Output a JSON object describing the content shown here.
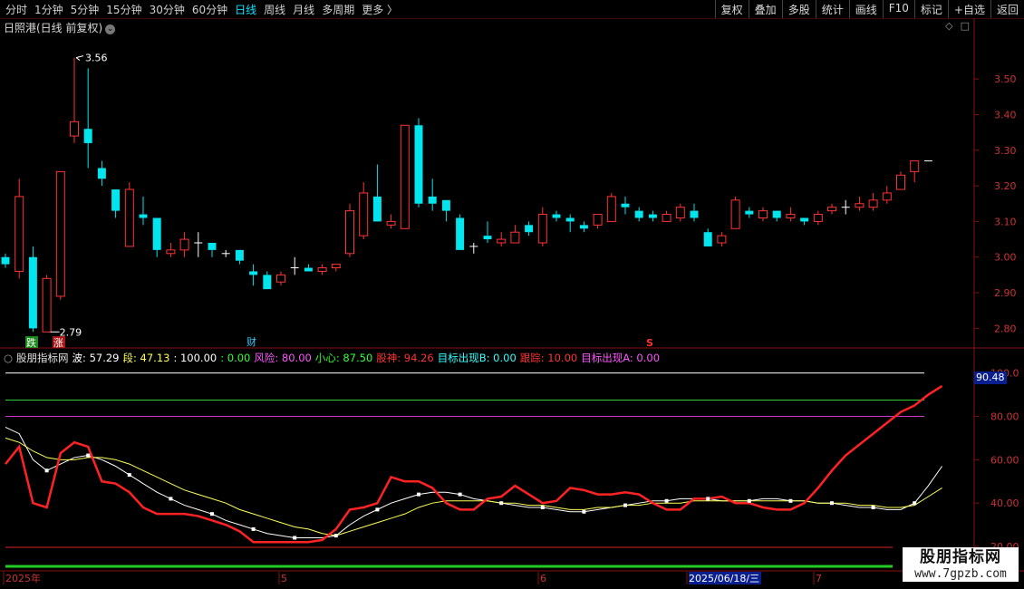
{
  "toolbar": {
    "periods": [
      "分时",
      "1分钟",
      "5分钟",
      "15分钟",
      "30分钟",
      "60分钟",
      "日线",
      "周线",
      "月线",
      "多周期",
      "更多"
    ],
    "active_period": "日线",
    "more_suffix": "〉",
    "right_buttons": [
      "复权",
      "叠加",
      "多股",
      "统计",
      "画线",
      "F10",
      "标记",
      "+自选",
      "返回"
    ]
  },
  "stock": {
    "title": "日照港(日线 前复权)",
    "chev": "⌄"
  },
  "top_icons": {
    "diamond": "◇",
    "square": "□"
  },
  "price_axis": {
    "ticks": [
      "3.50",
      "3.40",
      "3.30",
      "3.20",
      "3.10",
      "3.00",
      "2.90",
      "2.80"
    ]
  },
  "annotations": {
    "high": "3.56",
    "low": "2.79",
    "die": "跌",
    "zhang": "涨",
    "cai": "财",
    "s_mark": "S"
  },
  "indicator": {
    "name": "股朋指标网",
    "items": [
      {
        "label": "波:",
        "value": "57.29",
        "color": "#ffffff"
      },
      {
        "label": "段:",
        "value": "47.13",
        "color": "#ffff55"
      },
      {
        "label": ":",
        "value": "100.00",
        "color": "#ffffff"
      },
      {
        "label": ":",
        "value": "0.00",
        "color": "#33ff33"
      },
      {
        "label": "风险:",
        "value": "80.00",
        "color": "#ff55ff"
      },
      {
        "label": "小心:",
        "value": "87.50",
        "color": "#33ff33"
      },
      {
        "label": "股神:",
        "value": "94.26",
        "color": "#ff3333"
      },
      {
        "label": "目标出现B:",
        "value": "0.00",
        "color": "#33ffff"
      },
      {
        "label": "跟踪:",
        "value": "10.00",
        "color": "#ff3333"
      },
      {
        "label": "目标出现A:",
        "value": "0.00",
        "color": "#ff55ff"
      }
    ],
    "axis_ticks": [
      "100.0",
      "80.00",
      "60.00",
      "40.00",
      "20.00"
    ],
    "current_value": "90.48"
  },
  "time_axis": {
    "labels": [
      "2025年",
      "5",
      "6",
      "2025/06/18/三",
      "7"
    ]
  },
  "watermark": {
    "line1": "股朋指标网",
    "line2": "www.7gpzb.com"
  },
  "colors": {
    "up": "#ff3333",
    "down": "#00e5ee",
    "frame": "#8a1010",
    "bg": "#000000"
  },
  "chart_data": {
    "type": "candlestick",
    "ylim": [
      2.75,
      3.62
    ],
    "candles": [
      {
        "o": 3.0,
        "c": 2.98,
        "h": 3.01,
        "l": 2.97
      },
      {
        "o": 2.96,
        "c": 3.17,
        "h": 3.22,
        "l": 2.94
      },
      {
        "o": 3.0,
        "c": 2.8,
        "h": 3.03,
        "l": 2.79
      },
      {
        "o": 2.79,
        "c": 2.94,
        "h": 2.95,
        "l": 2.79
      },
      {
        "o": 2.89,
        "c": 3.24,
        "h": 3.24,
        "l": 2.88
      },
      {
        "o": 3.34,
        "c": 3.38,
        "h": 3.56,
        "l": 3.32
      },
      {
        "o": 3.36,
        "c": 3.32,
        "h": 3.53,
        "l": 3.25
      },
      {
        "o": 3.25,
        "c": 3.22,
        "h": 3.27,
        "l": 3.2
      },
      {
        "o": 3.19,
        "c": 3.13,
        "h": 3.19,
        "l": 3.11
      },
      {
        "o": 3.03,
        "c": 3.19,
        "h": 3.21,
        "l": 3.03
      },
      {
        "o": 3.12,
        "c": 3.11,
        "h": 3.17,
        "l": 3.09
      },
      {
        "o": 3.11,
        "c": 3.02,
        "h": 3.11,
        "l": 3.0
      },
      {
        "o": 3.01,
        "c": 3.02,
        "h": 3.04,
        "l": 3.0
      },
      {
        "o": 3.02,
        "c": 3.05,
        "h": 3.07,
        "l": 3.0
      },
      {
        "o": 3.04,
        "c": 3.04,
        "h": 3.07,
        "l": 3.0
      },
      {
        "o": 3.04,
        "c": 3.02,
        "h": 3.04,
        "l": 3.0
      },
      {
        "o": 3.01,
        "c": 3.01,
        "h": 3.02,
        "l": 3.0
      },
      {
        "o": 3.02,
        "c": 2.99,
        "h": 3.02,
        "l": 2.98
      },
      {
        "o": 2.96,
        "c": 2.95,
        "h": 2.98,
        "l": 2.92
      },
      {
        "o": 2.95,
        "c": 2.91,
        "h": 2.96,
        "l": 2.91
      },
      {
        "o": 2.93,
        "c": 2.95,
        "h": 2.96,
        "l": 2.92
      },
      {
        "o": 2.97,
        "c": 2.97,
        "h": 3.0,
        "l": 2.95
      },
      {
        "o": 2.97,
        "c": 2.96,
        "h": 2.98,
        "l": 2.96
      },
      {
        "o": 2.96,
        "c": 2.97,
        "h": 2.98,
        "l": 2.95
      },
      {
        "o": 2.97,
        "c": 2.98,
        "h": 2.98,
        "l": 2.96
      },
      {
        "o": 3.01,
        "c": 3.13,
        "h": 3.15,
        "l": 3.0
      },
      {
        "o": 3.06,
        "c": 3.18,
        "h": 3.21,
        "l": 3.05
      },
      {
        "o": 3.17,
        "c": 3.1,
        "h": 3.26,
        "l": 3.1
      },
      {
        "o": 3.09,
        "c": 3.1,
        "h": 3.12,
        "l": 3.08
      },
      {
        "o": 3.08,
        "c": 3.37,
        "h": 3.37,
        "l": 3.08
      },
      {
        "o": 3.37,
        "c": 3.15,
        "h": 3.39,
        "l": 3.14
      },
      {
        "o": 3.17,
        "c": 3.15,
        "h": 3.22,
        "l": 3.13
      },
      {
        "o": 3.16,
        "c": 3.13,
        "h": 3.16,
        "l": 3.1
      },
      {
        "o": 3.11,
        "c": 3.02,
        "h": 3.12,
        "l": 3.02
      },
      {
        "o": 3.03,
        "c": 3.03,
        "h": 3.04,
        "l": 3.01
      },
      {
        "o": 3.06,
        "c": 3.05,
        "h": 3.1,
        "l": 3.04
      },
      {
        "o": 3.04,
        "c": 3.05,
        "h": 3.07,
        "l": 3.03
      },
      {
        "o": 3.04,
        "c": 3.07,
        "h": 3.09,
        "l": 3.04
      },
      {
        "o": 3.09,
        "c": 3.07,
        "h": 3.1,
        "l": 3.06
      },
      {
        "o": 3.04,
        "c": 3.12,
        "h": 3.14,
        "l": 3.03
      },
      {
        "o": 3.12,
        "c": 3.11,
        "h": 3.13,
        "l": 3.1
      },
      {
        "o": 3.11,
        "c": 3.1,
        "h": 3.12,
        "l": 3.07
      },
      {
        "o": 3.09,
        "c": 3.08,
        "h": 3.1,
        "l": 3.07
      },
      {
        "o": 3.09,
        "c": 3.12,
        "h": 3.12,
        "l": 3.08
      },
      {
        "o": 3.1,
        "c": 3.17,
        "h": 3.18,
        "l": 3.1
      },
      {
        "o": 3.15,
        "c": 3.14,
        "h": 3.17,
        "l": 3.12
      },
      {
        "o": 3.13,
        "c": 3.11,
        "h": 3.14,
        "l": 3.1
      },
      {
        "o": 3.12,
        "c": 3.11,
        "h": 3.13,
        "l": 3.1
      },
      {
        "o": 3.1,
        "c": 3.12,
        "h": 3.13,
        "l": 3.1
      },
      {
        "o": 3.11,
        "c": 3.14,
        "h": 3.15,
        "l": 3.1
      },
      {
        "o": 3.13,
        "c": 3.11,
        "h": 3.15,
        "l": 3.1
      },
      {
        "o": 3.07,
        "c": 3.03,
        "h": 3.08,
        "l": 3.03
      },
      {
        "o": 3.04,
        "c": 3.06,
        "h": 3.07,
        "l": 3.03
      },
      {
        "o": 3.08,
        "c": 3.16,
        "h": 3.17,
        "l": 3.08
      },
      {
        "o": 3.13,
        "c": 3.12,
        "h": 3.14,
        "l": 3.11
      },
      {
        "o": 3.11,
        "c": 3.13,
        "h": 3.14,
        "l": 3.1
      },
      {
        "o": 3.13,
        "c": 3.11,
        "h": 3.13,
        "l": 3.1
      },
      {
        "o": 3.11,
        "c": 3.12,
        "h": 3.14,
        "l": 3.1
      },
      {
        "o": 3.11,
        "c": 3.1,
        "h": 3.11,
        "l": 3.09
      },
      {
        "o": 3.1,
        "c": 3.12,
        "h": 3.13,
        "l": 3.09
      },
      {
        "o": 3.13,
        "c": 3.14,
        "h": 3.15,
        "l": 3.12
      },
      {
        "o": 3.14,
        "c": 3.14,
        "h": 3.16,
        "l": 3.12
      },
      {
        "o": 3.14,
        "c": 3.15,
        "h": 3.17,
        "l": 3.13
      },
      {
        "o": 3.14,
        "c": 3.16,
        "h": 3.18,
        "l": 3.13
      },
      {
        "o": 3.16,
        "c": 3.18,
        "h": 3.2,
        "l": 3.15
      },
      {
        "o": 3.19,
        "c": 3.23,
        "h": 3.24,
        "l": 3.19
      },
      {
        "o": 3.24,
        "c": 3.27,
        "h": 3.27,
        "l": 3.21
      },
      {
        "o": 3.27,
        "c": 3.27,
        "h": 3.27,
        "l": 3.27
      }
    ],
    "indicator_ylim": [
      10,
      104
    ],
    "series": [
      {
        "name": "波",
        "color": "#ffffff",
        "values": [
          75,
          72,
          60,
          55,
          58,
          61,
          62,
          60,
          57,
          53,
          49,
          45,
          42,
          39,
          37,
          35,
          32,
          30,
          28,
          26,
          25,
          24,
          24,
          24,
          25,
          30,
          34,
          37,
          40,
          42,
          44,
          45,
          45,
          44,
          42,
          41,
          40,
          39,
          38,
          38,
          37,
          36,
          36,
          37,
          38,
          39,
          40,
          41,
          41,
          42,
          42,
          42,
          41,
          41,
          41,
          42,
          42,
          41,
          41,
          40,
          40,
          39,
          38,
          38,
          37,
          37,
          40,
          48,
          57
        ]
      },
      {
        "name": "段",
        "color": "#ffff55",
        "values": [
          70,
          68,
          64,
          61,
          60,
          60,
          61,
          61,
          60,
          58,
          55,
          52,
          49,
          46,
          44,
          42,
          40,
          37,
          35,
          33,
          31,
          29,
          28,
          26,
          25,
          27,
          29,
          31,
          33,
          35,
          38,
          40,
          41,
          41,
          41,
          41,
          40,
          40,
          39,
          39,
          38,
          37,
          37,
          38,
          38,
          39,
          39,
          40,
          40,
          40,
          41,
          41,
          41,
          41,
          41,
          41,
          41,
          41,
          41,
          40,
          40,
          40,
          39,
          39,
          38,
          38,
          39,
          43,
          47
        ]
      },
      {
        "name": "股神",
        "color": "#ff2222",
        "values": [
          58,
          66,
          40,
          38,
          63,
          68,
          66,
          50,
          49,
          45,
          38,
          35,
          35,
          35,
          34,
          32,
          30,
          27,
          22,
          22,
          22,
          22,
          22,
          23,
          28,
          37,
          38,
          40,
          52,
          50,
          50,
          47,
          40,
          37,
          37,
          42,
          43,
          48,
          44,
          40,
          41,
          47,
          46,
          44,
          44,
          45,
          44,
          40,
          37,
          37,
          42,
          42,
          43,
          40,
          40,
          38,
          37,
          37,
          40,
          47,
          55,
          62,
          67,
          72,
          77,
          82,
          85,
          90,
          94
        ]
      }
    ],
    "levels": [
      {
        "value": 100,
        "color": "#ffffff"
      },
      {
        "value": 87.5,
        "color": "#33cc33"
      },
      {
        "value": 80,
        "color": "#cc33cc"
      },
      {
        "value": 10,
        "color": "#dd2222"
      },
      {
        "value": 0,
        "color": "#22cc22"
      }
    ]
  }
}
